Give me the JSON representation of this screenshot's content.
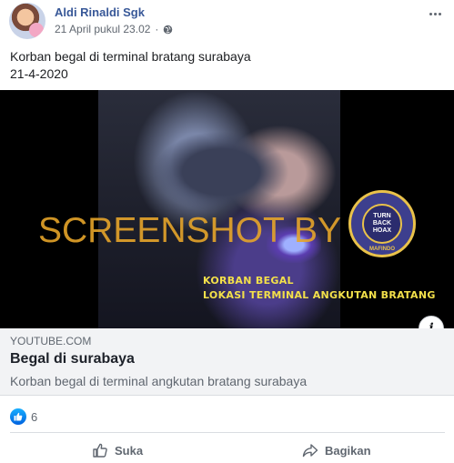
{
  "post": {
    "author": "Aldi Rinaldi Sgk",
    "timestamp": "21 April pukul 23.02",
    "separator": "·",
    "text_line1": "Korban begal di terminal bratang surabaya",
    "text_line2": "21-4-2020"
  },
  "video": {
    "watermark": "SCREENSHOT BY",
    "caption_line1": "KORBAN BEGAL",
    "caption_line2": "LOKASI TERMINAL ANGKUTAN BRATANG",
    "badge_text_1": "TURN",
    "badge_text_2": "BACK",
    "badge_text_3": "HOAX",
    "badge_bottom": "MAFINDO",
    "info_label": "i"
  },
  "link": {
    "domain": "YOUTUBE.COM",
    "title": "Begal di surabaya",
    "description": "Korban begal di terminal angkutan bratang surabaya"
  },
  "reactions": {
    "count": "6",
    "icon": "like-icon"
  },
  "actions": {
    "like_label": "Suka",
    "share_label": "Bagikan"
  },
  "colors": {
    "author": "#385898",
    "like_blue": "#1877f2",
    "watermark": "#e6a52a"
  }
}
